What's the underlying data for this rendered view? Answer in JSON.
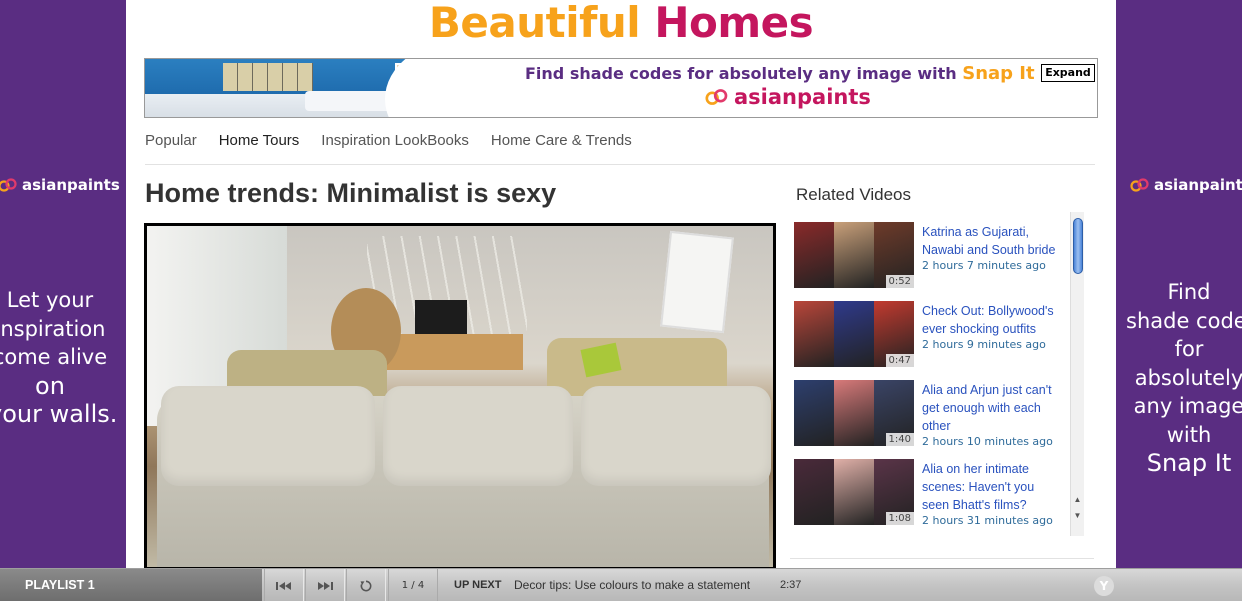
{
  "site": {
    "title_part1": "Beautiful",
    "title_part2": "Homes"
  },
  "side_ads": {
    "brand": "asianpaints",
    "left_lines": [
      "Let your",
      "inspiration",
      "come alive"
    ],
    "left_bold": [
      "on",
      "your walls."
    ],
    "right_lines": [
      "Find",
      "shade codes",
      "for",
      "absolutely",
      "any image",
      "with"
    ],
    "right_bold": "Snap It"
  },
  "banner": {
    "text": "Find shade codes for absolutely any image with",
    "highlight": "Snap It",
    "brand": "asianpaints",
    "expand_label": "Expand"
  },
  "nav": {
    "items": [
      {
        "label": "Popular",
        "active": false
      },
      {
        "label": "Home Tours",
        "active": true
      },
      {
        "label": "Inspiration LookBooks",
        "active": false
      },
      {
        "label": "Home Care & Trends",
        "active": false
      }
    ]
  },
  "article": {
    "headline": "Home trends: Minimalist is sexy"
  },
  "related": {
    "title": "Related Videos",
    "items": [
      {
        "title": "Katrina as Gujarati, Nawabi and South bride",
        "time": "2 hours 7 minutes ago",
        "duration": "0:52",
        "colors": [
          "#8a2a2a",
          "#c9a07a",
          "#6e3b2a"
        ]
      },
      {
        "title": "Check Out: Bollywood's ever shocking outfits",
        "time": "2 hours 9 minutes ago",
        "duration": "0:47",
        "colors": [
          "#b9463a",
          "#2f3a8c",
          "#c23a2f"
        ]
      },
      {
        "title": "Alia and Arjun just can't get enough with each other",
        "time": "2 hours 10 minutes ago",
        "duration": "1:40",
        "colors": [
          "#2d3f6e",
          "#d87a7a",
          "#3a4466"
        ]
      },
      {
        "title": "Alia on her intimate scenes: Haven't you seen Bhatt's films?",
        "time": "2 hours 31 minutes ago",
        "duration": "1:08",
        "colors": [
          "#4a2a3a",
          "#e0b0a8",
          "#5a3448"
        ]
      }
    ]
  },
  "player": {
    "playlist_label": "PLAYLIST 1",
    "count": "1 / 4",
    "upnext_label": "UP NEXT",
    "next_title": "Decor tips: Use colours to make a statement",
    "next_duration": "2:37",
    "logo_letter": "Y"
  }
}
